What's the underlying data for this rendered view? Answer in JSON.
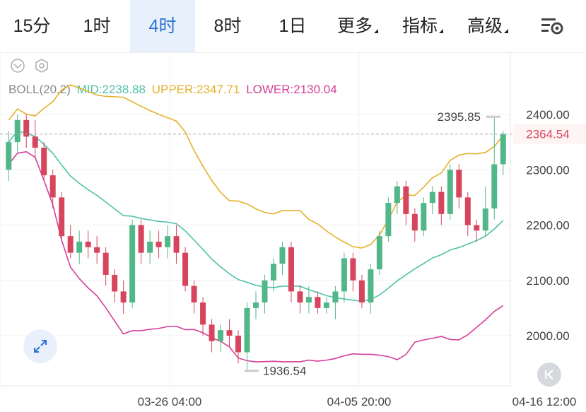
{
  "tabs": [
    {
      "label": "15分",
      "active": false,
      "has_menu": false
    },
    {
      "label": "1时",
      "active": false,
      "has_menu": false
    },
    {
      "label": "4时",
      "active": true,
      "has_menu": false
    },
    {
      "label": "8时",
      "active": false,
      "has_menu": false
    },
    {
      "label": "1日",
      "active": false,
      "has_menu": false
    },
    {
      "label": "更多",
      "active": false,
      "has_menu": true
    },
    {
      "label": "指标",
      "active": false,
      "has_menu": true
    },
    {
      "label": "高级",
      "active": false,
      "has_menu": true
    }
  ],
  "indicator": {
    "name": "BOLL(20,2)",
    "mid": "MID:2238.88",
    "upper": "UPPER:2347.71",
    "lower": "LOWER:2130.04"
  },
  "colors": {
    "accent": "#2d72d2",
    "up": "#52b788",
    "down": "#d6455d",
    "mid": "#4fc1a8",
    "upper": "#e5b12b",
    "lower": "#d63f9a"
  },
  "chart_data": {
    "type": "candlestick",
    "y_ticks": [
      "2400.00",
      "2300.00",
      "2200.00",
      "2100.00",
      "2000.00"
    ],
    "ylim": [
      1910,
      2450
    ],
    "x_ticks": [
      "03-26 04:00",
      "04-05 20:00",
      "04-16 12:00"
    ],
    "current_price": "2364.54",
    "high_marker": "2395.85",
    "low_marker": "1936.54",
    "grid": true,
    "candles_approx": [
      [
        2300,
        2350,
        2280,
        2370
      ],
      [
        2350,
        2390,
        2330,
        2400
      ],
      [
        2390,
        2360,
        2340,
        2400
      ],
      [
        2360,
        2340,
        2320,
        2390
      ],
      [
        2340,
        2290,
        2280,
        2350
      ],
      [
        2290,
        2250,
        2230,
        2300
      ],
      [
        2250,
        2180,
        2170,
        2260
      ],
      [
        2180,
        2150,
        2140,
        2200
      ],
      [
        2150,
        2170,
        2130,
        2190
      ],
      [
        2170,
        2160,
        2140,
        2190
      ],
      [
        2160,
        2150,
        2130,
        2180
      ],
      [
        2150,
        2110,
        2090,
        2160
      ],
      [
        2110,
        2080,
        2060,
        2120
      ],
      [
        2080,
        2060,
        2040,
        2100
      ],
      [
        2060,
        2200,
        2050,
        2210
      ],
      [
        2200,
        2150,
        2130,
        2210
      ],
      [
        2150,
        2170,
        2130,
        2190
      ],
      [
        2170,
        2160,
        2140,
        2190
      ],
      [
        2160,
        2180,
        2140,
        2200
      ],
      [
        2180,
        2150,
        2130,
        2200
      ],
      [
        2150,
        2090,
        2080,
        2160
      ],
      [
        2090,
        2060,
        2040,
        2100
      ],
      [
        2060,
        2020,
        2000,
        2070
      ],
      [
        2020,
        1990,
        1970,
        2030
      ],
      [
        1990,
        2010,
        1970,
        2020
      ],
      [
        2010,
        2000,
        1980,
        2030
      ],
      [
        2000,
        1970,
        1950,
        2010
      ],
      [
        1970,
        2050,
        1936,
        2060
      ],
      [
        2050,
        2060,
        2030,
        2080
      ],
      [
        2060,
        2100,
        2040,
        2110
      ],
      [
        2100,
        2130,
        2080,
        2140
      ],
      [
        2130,
        2160,
        2110,
        2170
      ],
      [
        2160,
        2080,
        2060,
        2170
      ],
      [
        2080,
        2060,
        2040,
        2090
      ],
      [
        2060,
        2070,
        2040,
        2090
      ],
      [
        2070,
        2050,
        2040,
        2080
      ],
      [
        2050,
        2060,
        2040,
        2070
      ],
      [
        2060,
        2080,
        2030,
        2090
      ],
      [
        2080,
        2140,
        2060,
        2150
      ],
      [
        2140,
        2100,
        2080,
        2150
      ],
      [
        2100,
        2060,
        2050,
        2110
      ],
      [
        2060,
        2120,
        2040,
        2130
      ],
      [
        2120,
        2180,
        2110,
        2190
      ],
      [
        2180,
        2240,
        2170,
        2250
      ],
      [
        2240,
        2270,
        2220,
        2280
      ],
      [
        2270,
        2220,
        2200,
        2280
      ],
      [
        2220,
        2190,
        2170,
        2230
      ],
      [
        2190,
        2240,
        2180,
        2250
      ],
      [
        2240,
        2260,
        2220,
        2270
      ],
      [
        2260,
        2220,
        2200,
        2270
      ],
      [
        2220,
        2300,
        2210,
        2310
      ],
      [
        2300,
        2250,
        2230,
        2310
      ],
      [
        2250,
        2200,
        2180,
        2260
      ],
      [
        2200,
        2190,
        2170,
        2210
      ],
      [
        2190,
        2230,
        2180,
        2270
      ],
      [
        2230,
        2310,
        2210,
        2396
      ],
      [
        2310,
        2364.54,
        2290,
        2370
      ]
    ]
  }
}
